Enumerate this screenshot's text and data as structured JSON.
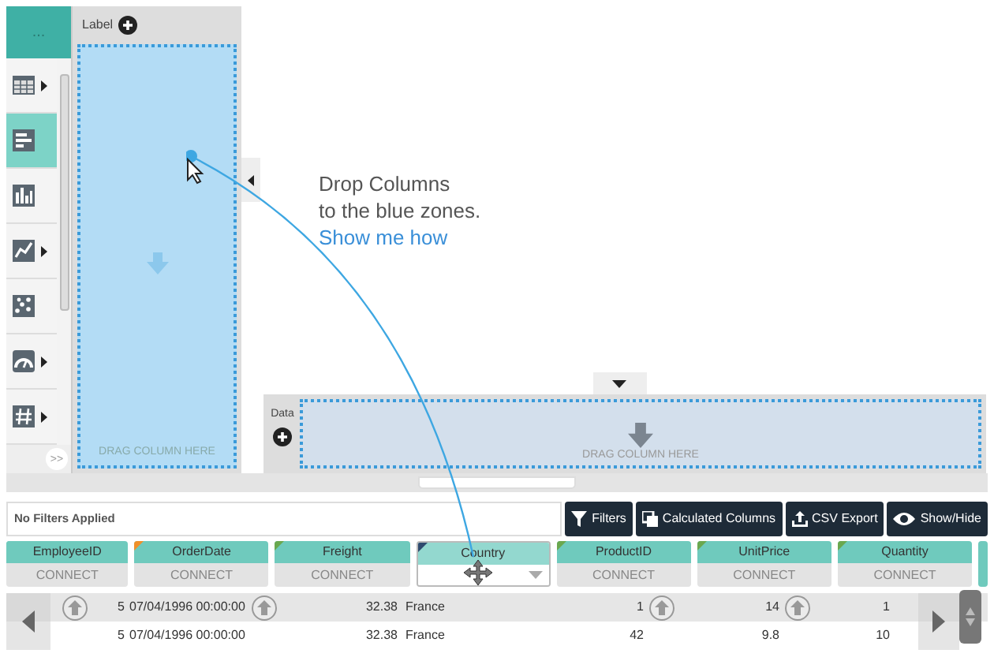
{
  "sidebar": {
    "header": "...",
    "items": [
      {
        "kind": "table",
        "selected": false,
        "submenu": true
      },
      {
        "kind": "bars",
        "selected": true,
        "submenu": false
      },
      {
        "kind": "columns",
        "selected": false,
        "submenu": false
      },
      {
        "kind": "line",
        "selected": false,
        "submenu": true
      },
      {
        "kind": "scatter",
        "selected": false,
        "submenu": false
      },
      {
        "kind": "gauge",
        "selected": false,
        "submenu": true
      },
      {
        "kind": "number",
        "selected": false,
        "submenu": true
      }
    ],
    "more": ">>"
  },
  "label_zone": {
    "title": "Label",
    "hint": "DRAG COLUMN HERE"
  },
  "message": {
    "lines": [
      "Drop Columns",
      "to the blue zones."
    ],
    "link": "Show me how"
  },
  "data_zone": {
    "title": "Data",
    "hint": "DRAG COLUMN HERE"
  },
  "filters": {
    "status": "No Filters Applied",
    "buttons": [
      {
        "kind": "filter",
        "label": "Filters"
      },
      {
        "kind": "calc",
        "label": "Calculated Columns"
      },
      {
        "kind": "export",
        "label": "CSV Export"
      },
      {
        "kind": "eye",
        "label": "Show/Hide"
      }
    ]
  },
  "columns": [
    {
      "name": "EmployeeID",
      "action": "CONNECT",
      "color": "#6fcabd",
      "dragging": false
    },
    {
      "name": "OrderDate",
      "action": "CONNECT",
      "color": "#f0902a",
      "dragging": false
    },
    {
      "name": "Freight",
      "action": "CONNECT",
      "color": "#6aa84f",
      "dragging": false
    },
    {
      "name": "Country",
      "color": "#2e4a6e",
      "dragging": true
    },
    {
      "name": "ProductID",
      "action": "CONNECT",
      "color": "#6aa84f",
      "dragging": false
    },
    {
      "name": "UnitPrice",
      "action": "CONNECT",
      "color": "#6aa84f",
      "dragging": false
    },
    {
      "name": "Quantity",
      "action": "CONNECT",
      "color": "#6aa84f",
      "dragging": false
    }
  ],
  "rows": [
    [
      "5",
      "07/04/1996 00:00:00",
      "32.38",
      "France",
      "1",
      "14",
      "1"
    ],
    [
      "5",
      "07/04/1996 00:00:00",
      "32.38",
      "France",
      "42",
      "9.8",
      "10"
    ]
  ]
}
